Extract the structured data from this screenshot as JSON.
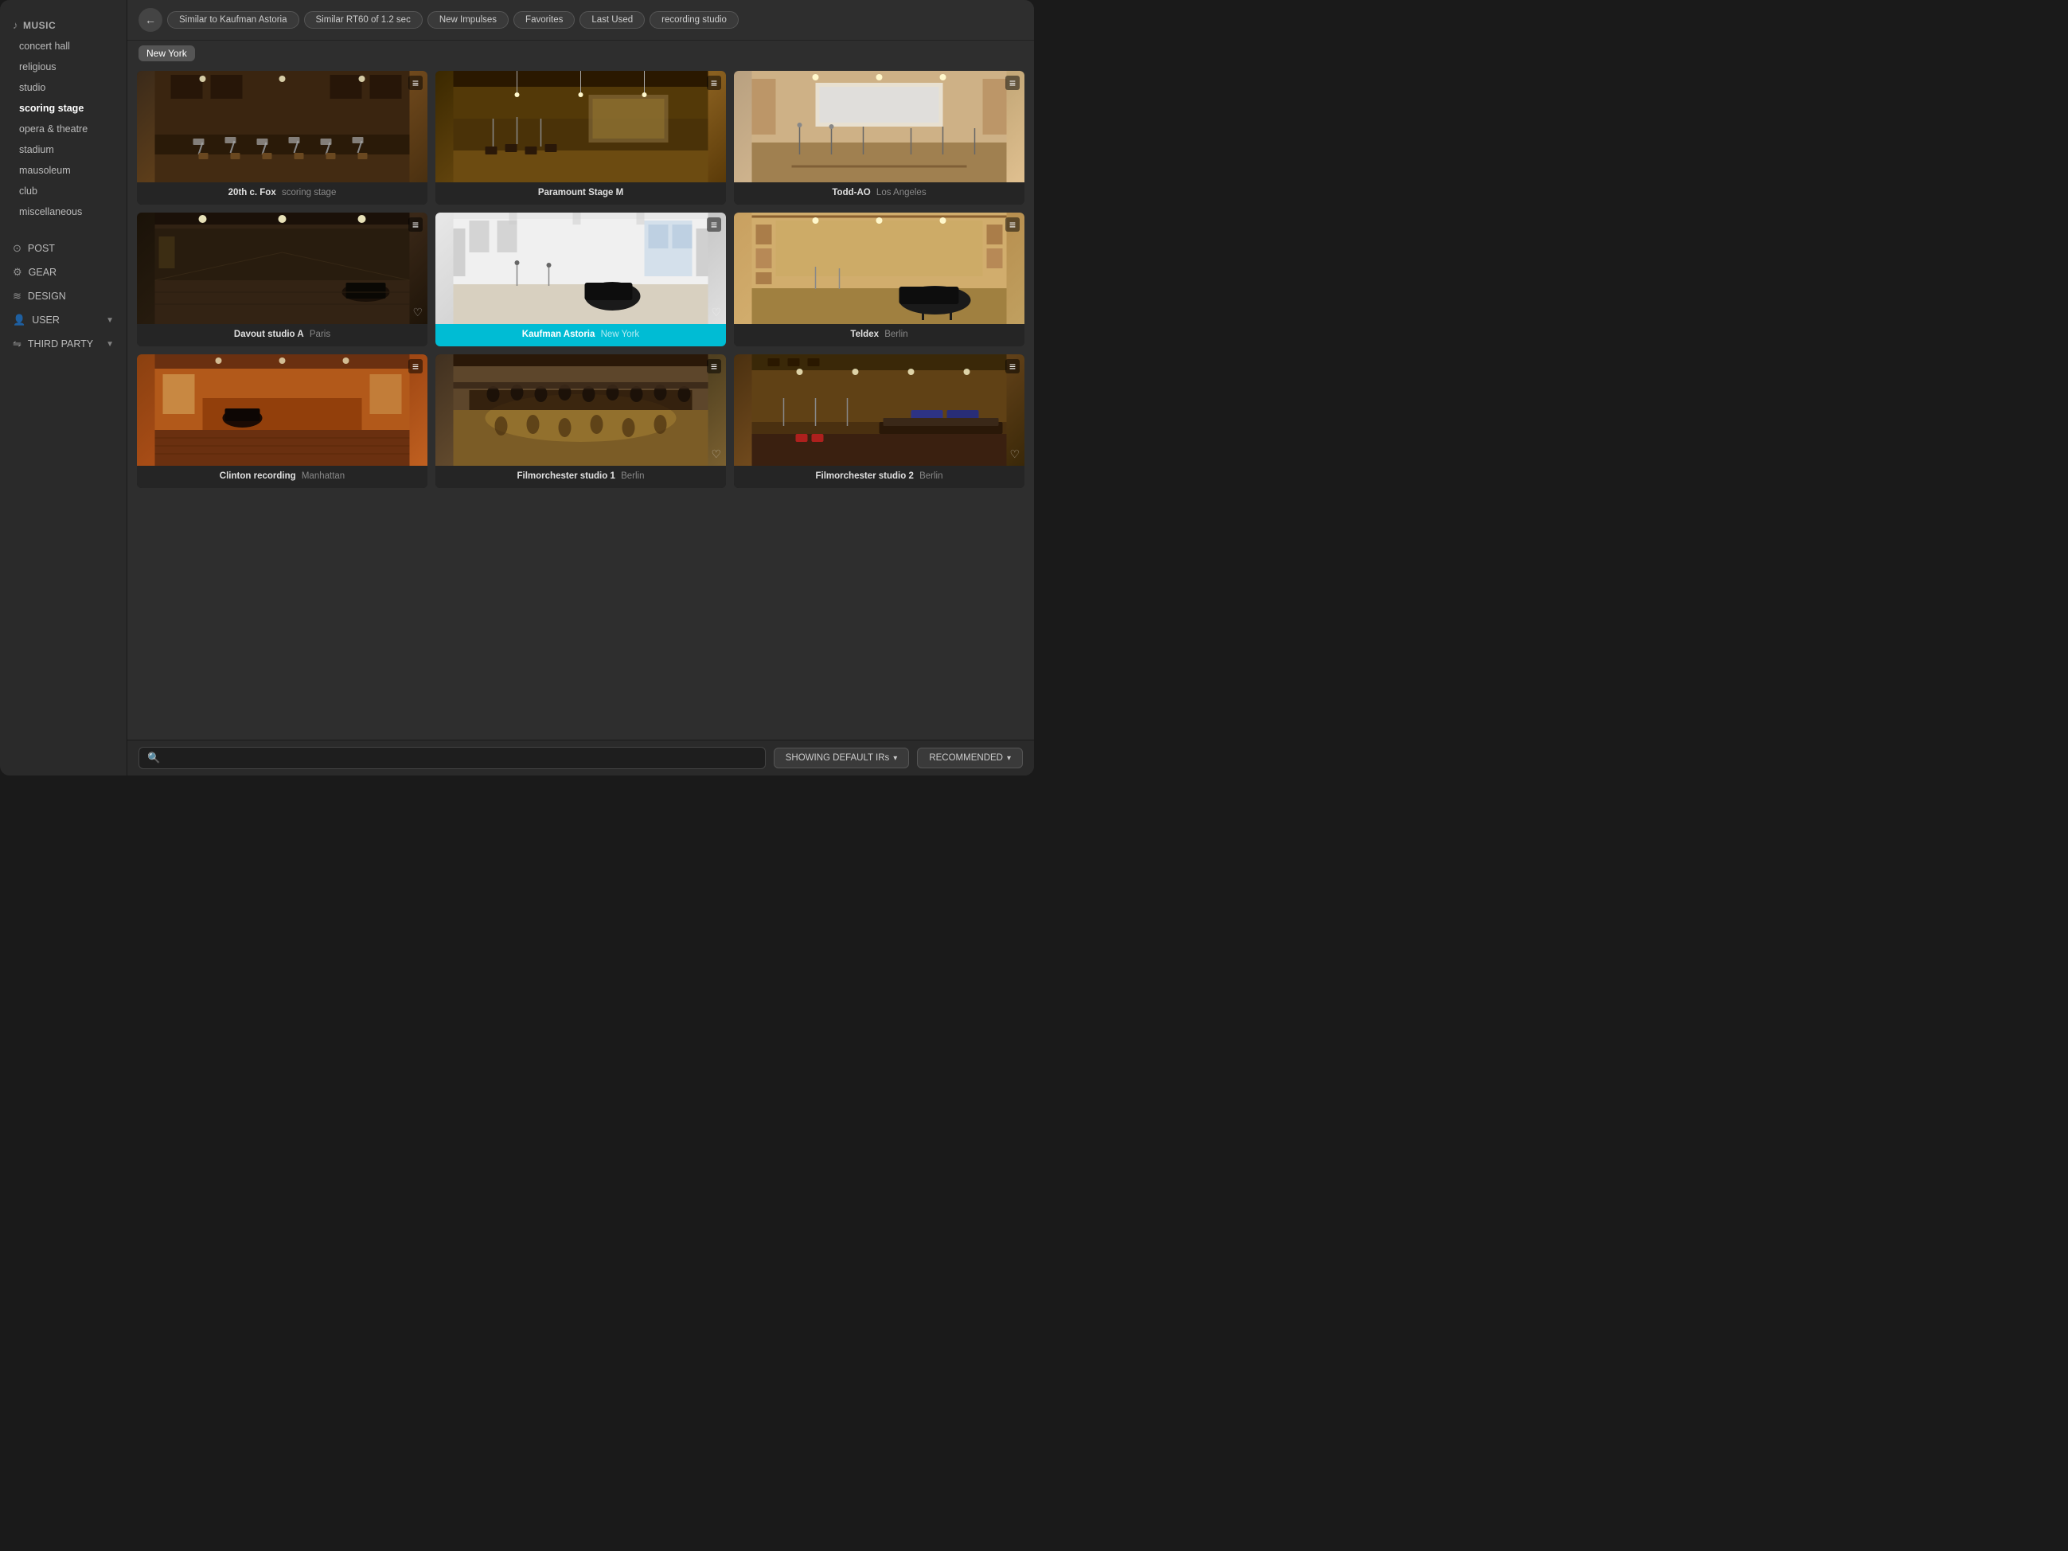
{
  "sidebar": {
    "music_label": "MUSIC",
    "items": [
      {
        "label": "concert hall",
        "active": false,
        "id": "concert-hall"
      },
      {
        "label": "religious",
        "active": false,
        "id": "religious"
      },
      {
        "label": "studio",
        "active": false,
        "id": "studio"
      },
      {
        "label": "scoring stage",
        "active": true,
        "id": "scoring-stage"
      },
      {
        "label": "opera & theatre",
        "active": false,
        "id": "opera-theatre"
      },
      {
        "label": "stadium",
        "active": false,
        "id": "stadium"
      },
      {
        "label": "mausoleum",
        "active": false,
        "id": "mausoleum"
      },
      {
        "label": "club",
        "active": false,
        "id": "club"
      },
      {
        "label": "miscellaneous",
        "active": false,
        "id": "miscellaneous"
      }
    ],
    "post_label": "POST",
    "gear_label": "GEAR",
    "design_label": "DESIGN",
    "user_label": "USER",
    "third_party_label": "THIRD PARTY"
  },
  "filter_bar": {
    "back_title": "Back",
    "chips": [
      "Similar to Kaufman Astoria",
      "Similar RT60 of 1.2 sec",
      "New Impulses",
      "Favorites",
      "Last Used",
      "recording studio"
    ]
  },
  "location_tag": "New York",
  "venues": [
    {
      "id": "20fox",
      "name": "20th c. Fox",
      "sub": "scoring stage",
      "location": "",
      "selected": false,
      "has_heart": false,
      "thumb_class": "thumb-20fox"
    },
    {
      "id": "paramount",
      "name": "Paramount Stage M",
      "sub": "",
      "location": "",
      "selected": false,
      "has_heart": false,
      "thumb_class": "thumb-paramount"
    },
    {
      "id": "toddao",
      "name": "Todd-AO",
      "sub": "Los Angeles",
      "location": "",
      "selected": false,
      "has_heart": false,
      "thumb_class": "thumb-toddao"
    },
    {
      "id": "davout",
      "name": "Davout studio A",
      "sub": "Paris",
      "location": "",
      "selected": false,
      "has_heart": true,
      "thumb_class": "thumb-davout"
    },
    {
      "id": "kaufman",
      "name": "Kaufman Astoria",
      "sub": "New York",
      "location": "",
      "selected": true,
      "has_heart": true,
      "thumb_class": "thumb-kaufman"
    },
    {
      "id": "teldex",
      "name": "Teldex",
      "sub": "Berlin",
      "location": "",
      "selected": false,
      "has_heart": false,
      "thumb_class": "thumb-teldex"
    },
    {
      "id": "clinton",
      "name": "Clinton recording",
      "sub": "Manhattan",
      "location": "",
      "selected": false,
      "has_heart": false,
      "thumb_class": "thumb-clinton"
    },
    {
      "id": "filmo1",
      "name": "Filmorchester studio 1",
      "sub": "Berlin",
      "location": "",
      "selected": false,
      "has_heart": true,
      "thumb_class": "thumb-filmo1"
    },
    {
      "id": "filmo2",
      "name": "Filmorchester studio 2",
      "sub": "Berlin",
      "location": "",
      "selected": false,
      "has_heart": true,
      "thumb_class": "thumb-filmo2"
    }
  ],
  "bottom_bar": {
    "search_placeholder": "",
    "showing_btn": "SHOWING DEFAULT IRs",
    "recommended_btn": "RECOMMENDED"
  }
}
